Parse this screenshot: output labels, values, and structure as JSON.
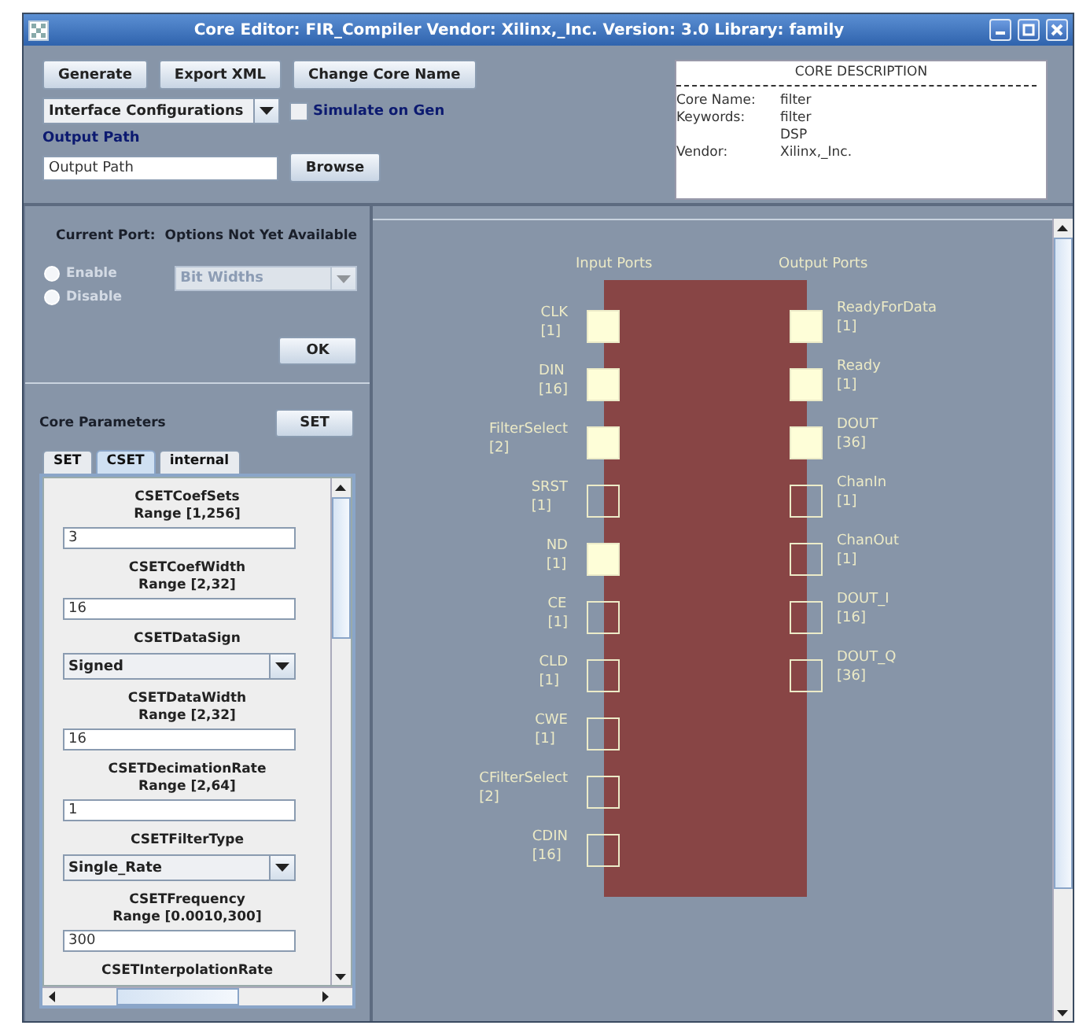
{
  "window": {
    "title": "Core Editor: FIR_Compiler Vendor: Xilinx,_Inc. Version: 3.0 Library: family"
  },
  "toolbar": {
    "buttons": [
      "Generate",
      "Export XML",
      "Change Core Name"
    ],
    "configuration_select": "Interface Configurations",
    "simulate_on_gen": {
      "label": "Simulate on Gen",
      "checked": false
    },
    "output_path_label": "Output Path",
    "output_path": "Output Path",
    "browse_button": "Browse"
  },
  "core_description": {
    "title": "CORE DESCRIPTION",
    "rows": [
      {
        "key": "Core Name:",
        "values": [
          "filter"
        ]
      },
      {
        "key": "Keywords:",
        "values": [
          "filter",
          "DSP"
        ]
      },
      {
        "key": "Vendor:",
        "values": [
          "Xilinx,_Inc."
        ]
      }
    ]
  },
  "current_port": {
    "label": "Current Port:",
    "value": "Options Not Yet Available",
    "radios": [
      {
        "label": "Enable",
        "selected": false,
        "disabled": true
      },
      {
        "label": "Disable",
        "selected": false,
        "disabled": true
      }
    ],
    "width_select": {
      "value": "Bit Widths",
      "disabled": true
    },
    "ok_button": "OK"
  },
  "core_parameters": {
    "label": "Core Parameters",
    "set_button": "SET",
    "tabs": [
      {
        "label": "SET",
        "selected": false
      },
      {
        "label": "CSET",
        "selected": true
      },
      {
        "label": "internal",
        "selected": false
      }
    ],
    "params": [
      {
        "kind": "text",
        "name": "CSETCoefSets",
        "range": "Range [1,256]",
        "value": "3"
      },
      {
        "kind": "text",
        "name": "CSETCoefWidth",
        "range": "Range [2,32]",
        "value": "16"
      },
      {
        "kind": "select",
        "name": "CSETDataSign",
        "value": "Signed"
      },
      {
        "kind": "text",
        "name": "CSETDataWidth",
        "range": "Range [2,32]",
        "value": "16"
      },
      {
        "kind": "text",
        "name": "CSETDecimationRate",
        "range": "Range [2,64]",
        "value": "1"
      },
      {
        "kind": "select",
        "name": "CSETFilterType",
        "value": "Single_Rate"
      },
      {
        "kind": "text",
        "name": "CSETFrequency",
        "range": "Range [0.0010,300]",
        "value": "300"
      },
      {
        "kind": "label",
        "name": "CSETInterpolationRate"
      }
    ]
  },
  "diagram": {
    "input_title": "Input Ports",
    "output_title": "Output Ports",
    "inputs": [
      {
        "name": "CLK",
        "width": "[1]",
        "enabled": true
      },
      {
        "name": "DIN",
        "width": "[16]",
        "enabled": true
      },
      {
        "name": "FilterSelect",
        "width": "[2]",
        "enabled": true
      },
      {
        "name": "SRST",
        "width": "[1]",
        "enabled": false
      },
      {
        "name": "ND",
        "width": "[1]",
        "enabled": true
      },
      {
        "name": "CE",
        "width": "[1]",
        "enabled": false
      },
      {
        "name": "CLD",
        "width": "[1]",
        "enabled": false
      },
      {
        "name": "CWE",
        "width": "[1]",
        "enabled": false
      },
      {
        "name": "CFilterSelect",
        "width": "[2]",
        "enabled": false
      },
      {
        "name": "CDIN",
        "width": "[16]",
        "enabled": false
      }
    ],
    "outputs": [
      {
        "name": "ReadyForData",
        "width": "[1]",
        "enabled": true
      },
      {
        "name": "Ready",
        "width": "[1]",
        "enabled": true
      },
      {
        "name": "DOUT",
        "width": "[36]",
        "enabled": true
      },
      {
        "name": "ChanIn",
        "width": "[1]",
        "enabled": false
      },
      {
        "name": "ChanOut",
        "width": "[1]",
        "enabled": false
      },
      {
        "name": "DOUT_I",
        "width": "[16]",
        "enabled": false
      },
      {
        "name": "DOUT_Q",
        "width": "[36]",
        "enabled": false
      }
    ]
  }
}
